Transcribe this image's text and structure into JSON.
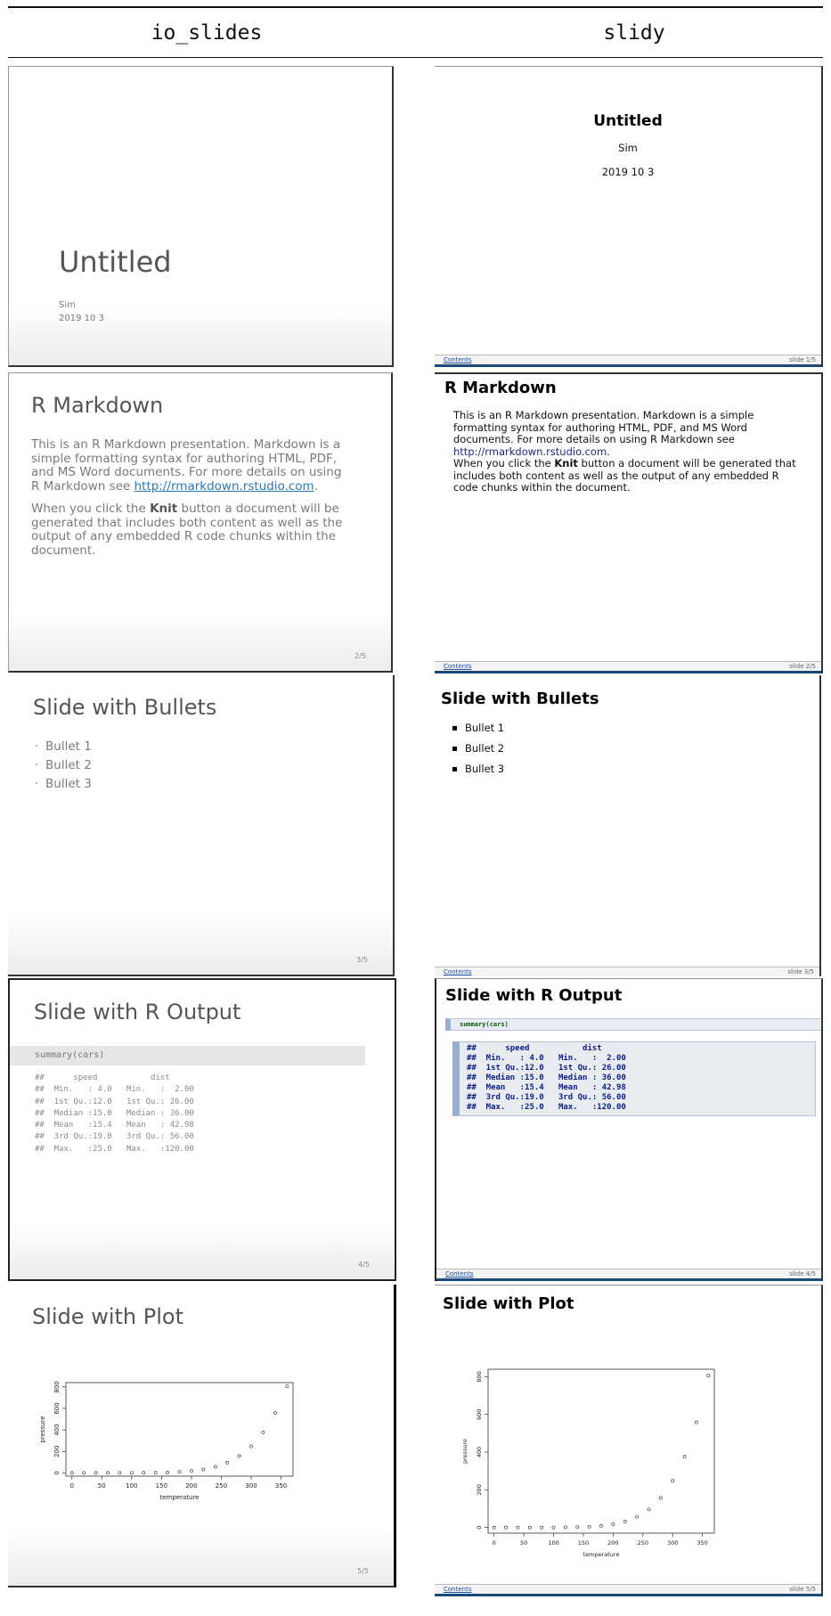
{
  "columns": {
    "left": "io_slides",
    "right": "slidy"
  },
  "title_slide": {
    "title": "Untitled",
    "author": "Sim",
    "date": "2019 10 3"
  },
  "rmarkdown_slide": {
    "title": "R Markdown",
    "p1_before": "This is an R Markdown presentation. Markdown is a simple formatting syntax for authoring HTML, PDF, and MS Word documents. For more details on using R Markdown see ",
    "p1_link": "http://rmarkdown.rstudio.com",
    "p1_after": ".",
    "p2_before": "When you click the ",
    "p2_bold": "Knit",
    "p2_after": " button a document will be generated that includes both content as well as the output of any embedded R code chunks within the document."
  },
  "bullets_slide": {
    "title": "Slide with Bullets",
    "bullets": [
      "Bullet 1",
      "Bullet 2",
      "Bullet 3"
    ]
  },
  "output_slide": {
    "title": "Slide with R Output",
    "code": "summary(cars)",
    "output_lines": [
      "##      speed           dist       ",
      "##  Min.   : 4.0   Min.   :  2.00  ",
      "##  1st Qu.:12.0   1st Qu.: 26.00  ",
      "##  Median :15.0   Median : 36.00  ",
      "##  Mean   :15.4   Mean   : 42.98  ",
      "##  3rd Qu.:19.0   3rd Qu.: 56.00  ",
      "##  Max.   :25.0   Max.   :120.00  "
    ]
  },
  "plot_slide": {
    "title": "Slide with Plot"
  },
  "io_slide_numbers": [
    "2/5",
    "3/5",
    "4/5",
    "5/5"
  ],
  "slidy_footer": {
    "contents_label": "Contents",
    "slide_numbers": [
      "slide 1/5",
      "slide 2/5",
      "slide 3/5",
      "slide 4/5",
      "slide 5/5"
    ]
  },
  "chart_data": {
    "type": "scatter",
    "xlabel": "temperature",
    "ylabel": "pressure",
    "x_ticks": [
      0,
      50,
      100,
      150,
      200,
      250,
      300,
      350
    ],
    "y_ticks": [
      0,
      200,
      400,
      600,
      800
    ],
    "xlim": [
      -10,
      370
    ],
    "ylim": [
      -30,
      840
    ],
    "points": [
      [
        0,
        0.0002
      ],
      [
        20,
        0.0012
      ],
      [
        40,
        0.006
      ],
      [
        60,
        0.03
      ],
      [
        80,
        0.09
      ],
      [
        100,
        0.27
      ],
      [
        120,
        0.75
      ],
      [
        140,
        1.85
      ],
      [
        160,
        4.2
      ],
      [
        180,
        8.8
      ],
      [
        200,
        17.3
      ],
      [
        220,
        32.1
      ],
      [
        240,
        57
      ],
      [
        260,
        96
      ],
      [
        280,
        157
      ],
      [
        300,
        247
      ],
      [
        320,
        376
      ],
      [
        340,
        558
      ],
      [
        360,
        806
      ]
    ]
  }
}
